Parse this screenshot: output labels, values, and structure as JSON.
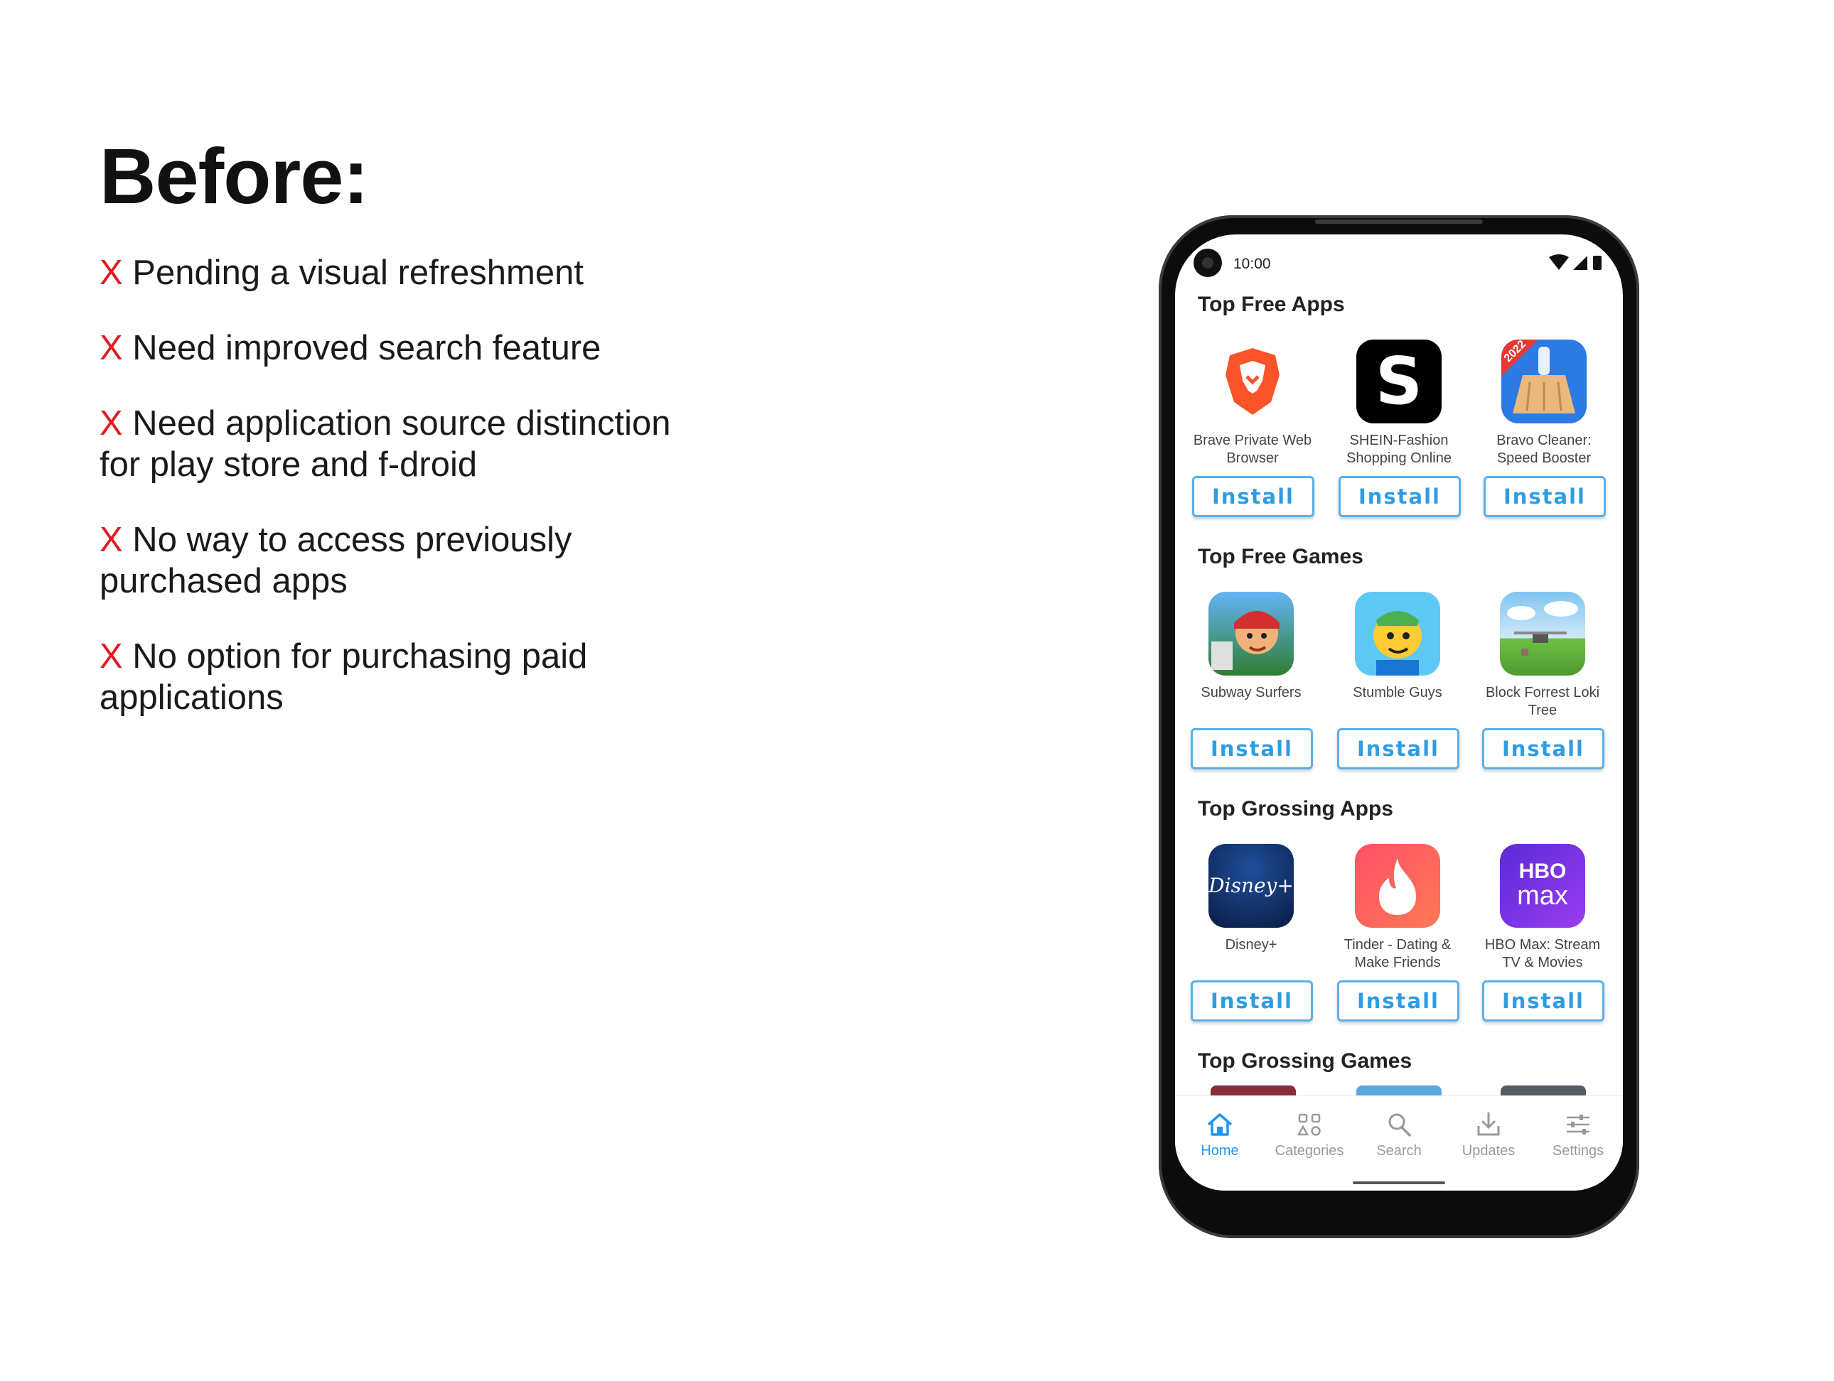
{
  "slide": {
    "title": "Before:",
    "issues": [
      {
        "marker": "X",
        "text": " Pending a visual refreshment"
      },
      {
        "marker": "X",
        "text": " Need improved search feature"
      },
      {
        "marker": "X",
        "text": " Need application source distinction for play store and f-droid"
      },
      {
        "marker": "X",
        "text": " No way to access previously purchased apps"
      },
      {
        "marker": "X",
        "text": " No option for purchasing paid applications"
      }
    ]
  },
  "phone": {
    "status_time": "10:00",
    "sections": [
      {
        "title": "Top Free Apps",
        "apps": [
          {
            "name": "Brave Private Web Browser",
            "icon": "brave-lion-icon",
            "install": "Install"
          },
          {
            "name": "SHEIN-Fashion Shopping Online",
            "icon": "shein-s-icon",
            "install": "Install"
          },
          {
            "name": "Bravo Cleaner: Speed Booster",
            "icon": "bravo-broom-icon",
            "install": "Install"
          }
        ]
      },
      {
        "title": "Top Free Games",
        "apps": [
          {
            "name": "Subway Surfers",
            "icon": "subway-surfers-icon",
            "install": "Install"
          },
          {
            "name": "Stumble Guys",
            "icon": "stumble-guys-icon",
            "install": "Install"
          },
          {
            "name": "Block Forrest Loki Tree",
            "icon": "block-forrest-icon",
            "install": "Install"
          }
        ]
      },
      {
        "title": "Top Grossing Apps",
        "apps": [
          {
            "name": "Disney+",
            "icon": "disney-plus-icon",
            "install": "Install"
          },
          {
            "name": "Tinder - Dating & Make Friends",
            "icon": "tinder-flame-icon",
            "install": "Install"
          },
          {
            "name": "HBO Max: Stream TV & Movies",
            "icon": "hbo-max-icon",
            "install": "Install"
          }
        ]
      },
      {
        "title": "Top Grossing Games",
        "apps": []
      }
    ],
    "nav": [
      {
        "label": "Home",
        "icon": "home-icon",
        "active": true
      },
      {
        "label": "Categories",
        "icon": "categories-icon",
        "active": false
      },
      {
        "label": "Search",
        "icon": "search-icon",
        "active": false
      },
      {
        "label": "Updates",
        "icon": "download-icon",
        "active": false
      },
      {
        "label": "Settings",
        "icon": "settings-sliders-icon",
        "active": false
      }
    ],
    "icon_text": {
      "disney": "Disney+",
      "hbo_top": "HBO",
      "hbo_bottom": "max",
      "bravo_badge": "2022",
      "shein": "S"
    },
    "colors": {
      "accent": "#2196f3",
      "install_border": "#5ab0e8",
      "issue_marker": "#e01b24"
    }
  }
}
